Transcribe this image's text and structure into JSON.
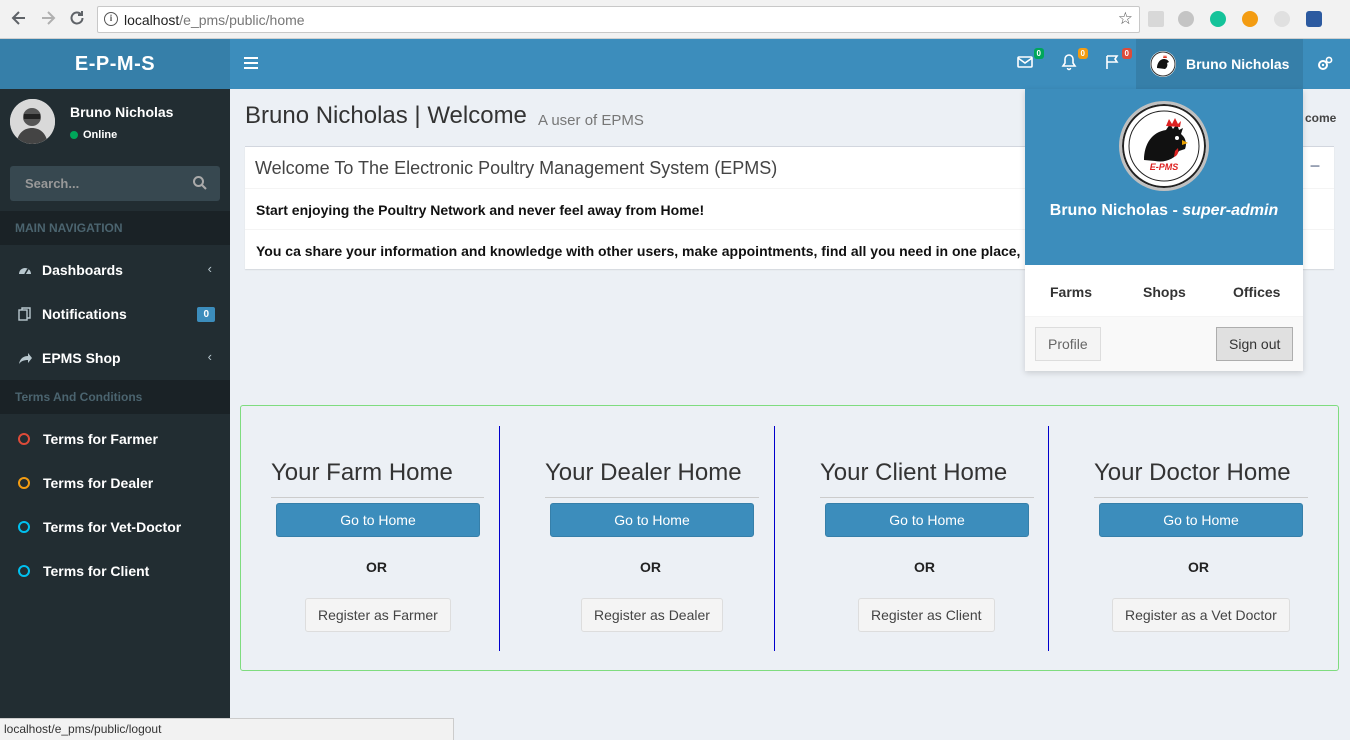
{
  "browser": {
    "url_host": "localhost",
    "url_path": "/e_pms/public/home"
  },
  "app": {
    "logo": "E-P-M-S",
    "user_name": "Bruno Nicholas",
    "mail_count": "0",
    "bell_count": "0",
    "flag_count": "0"
  },
  "sidebar": {
    "user_name": "Bruno Nicholas",
    "status": "Online",
    "search_placeholder": "Search...",
    "main_nav_header": "MAIN NAVIGATION",
    "items": [
      {
        "label": "Dashboards"
      },
      {
        "label": "Notifications",
        "badge": "0"
      },
      {
        "label": "EPMS Shop"
      }
    ],
    "terms_header": "Terms And Conditions",
    "terms": [
      {
        "label": "Terms for Farmer",
        "color": "#dd4b39"
      },
      {
        "label": "Terms for Dealer",
        "color": "#f39c12"
      },
      {
        "label": "Terms for Vet-Doctor",
        "color": "#00c0ef"
      },
      {
        "label": "Terms for Client",
        "color": "#00c0ef"
      }
    ]
  },
  "content": {
    "title": "Bruno Nicholas | Welcome",
    "subtitle": "A user of EPMS",
    "breadcrumb_fragment": "come",
    "welcome_title": "Welcome To The Electronic Poultry Management System (EPMS)",
    "welcome_line1": "Start enjoying the Poultry Network and never feel away from Home!",
    "welcome_line2": "You ca share your information and knowledge with other users, make appointments, find all you need in one place,",
    "homes": [
      {
        "title": "Your Farm Home",
        "go": "Go to Home",
        "or": "OR",
        "register": "Register as Farmer"
      },
      {
        "title": "Your Dealer Home",
        "go": "Go to Home",
        "or": "OR",
        "register": "Register as Dealer"
      },
      {
        "title": "Your Client Home",
        "go": "Go to Home",
        "or": "OR",
        "register": "Register as Client"
      },
      {
        "title": "Your Doctor Home",
        "go": "Go to Home",
        "or": "OR",
        "register": "Register as a Vet Doctor"
      }
    ]
  },
  "dropdown": {
    "name": "Bruno Nicholas",
    "separator": " - ",
    "role": "super-admin",
    "logo_text": "E-PMS",
    "links": [
      "Farms",
      "Shops",
      "Offices"
    ],
    "profile": "Profile",
    "signout": "Sign out"
  },
  "status_bar": {
    "text": "localhost/e_pms/public/logout"
  },
  "colors": {
    "primary": "#3c8dbc",
    "primary_dark": "#367fa9",
    "sidebar_bg": "#222d32"
  }
}
